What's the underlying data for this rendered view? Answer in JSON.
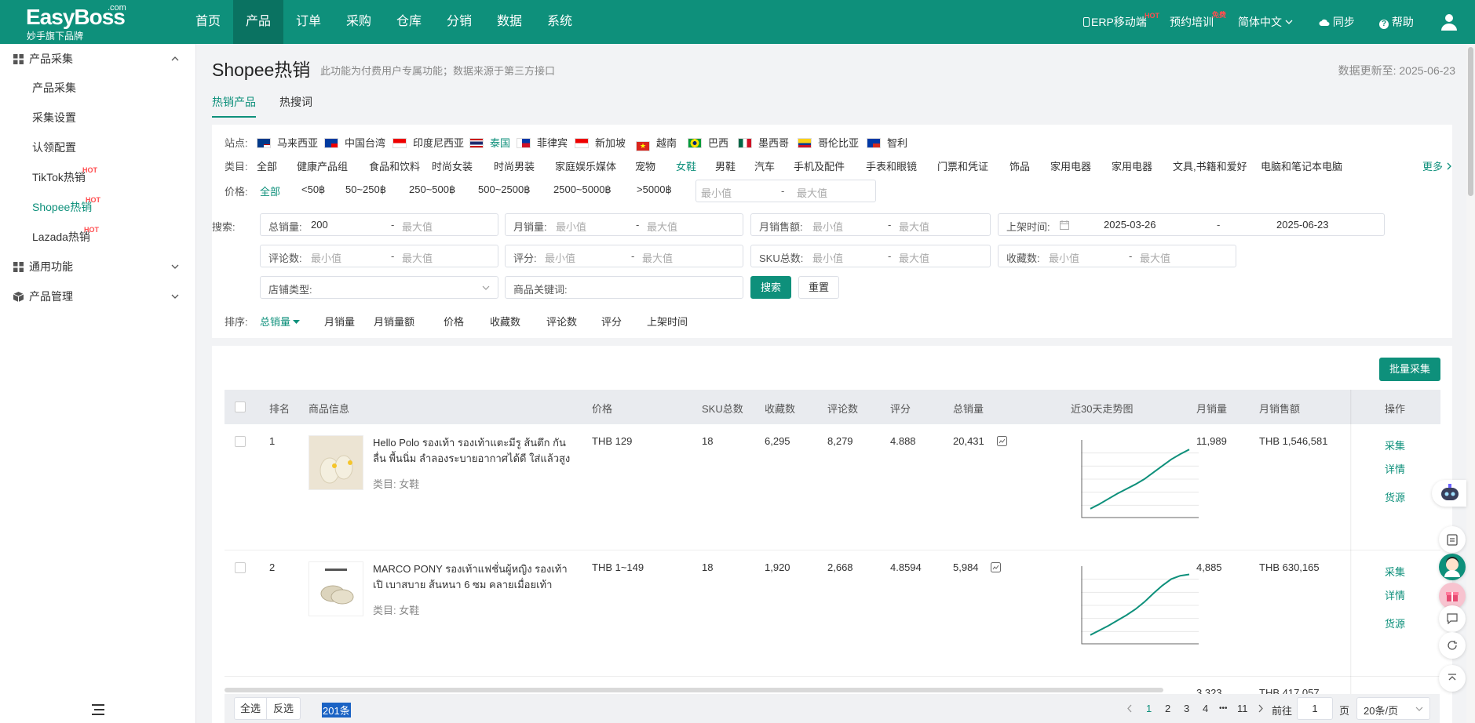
{
  "header": {
    "logo_main": "EasyBoss",
    "logo_com": ".com",
    "logo_sub": "妙手旗下品牌",
    "nav": [
      "首页",
      "产品",
      "订单",
      "采购",
      "仓库",
      "分销",
      "数据",
      "系统"
    ],
    "active_nav": "产品",
    "right": {
      "erp": "ERP移动端",
      "erp_badge": "HOT",
      "training": "预约培训",
      "training_badge": "免费",
      "lang": "简体中文",
      "sync": "同步",
      "help": "帮助"
    }
  },
  "sidebar": {
    "groups": [
      {
        "label": "产品采集",
        "expanded": true
      },
      {
        "label": "通用功能",
        "expanded": false
      },
      {
        "label": "产品管理",
        "expanded": false
      }
    ],
    "items": [
      {
        "label": "产品采集"
      },
      {
        "label": "采集设置"
      },
      {
        "label": "认领配置"
      },
      {
        "label": "TikTok热销",
        "badge": "HOT"
      },
      {
        "label": "Shopee热销",
        "badge": "HOT",
        "active": true
      },
      {
        "label": "Lazada热销",
        "badge": "HOT"
      }
    ]
  },
  "page": {
    "title": "Shopee热销",
    "note": "此功能为付费用户专属功能；数据来源于第三方接口",
    "updated": "数据更新至:  2025-06-23",
    "tabs": [
      "热销产品",
      "热搜词"
    ]
  },
  "filters": {
    "site_label": "站点:",
    "sites": [
      "马来西亚",
      "中国台湾",
      "印度尼西亚",
      "泰国",
      "菲律宾",
      "新加坡",
      "越南",
      "巴西",
      "墨西哥",
      "哥伦比亚",
      "智利"
    ],
    "active_site": "泰国",
    "category_label": "类目:",
    "categories": [
      "全部",
      "健康产品组",
      "食品和饮料",
      "时尚女装",
      "时尚男装",
      "家庭娱乐媒体",
      "宠物",
      "女鞋",
      "男鞋",
      "汽车",
      "手机及配件",
      "手表和眼镜",
      "门票和凭证",
      "饰品",
      "家用电器",
      "家用电器",
      "文具,书籍和爱好",
      "电脑和笔记本电脑"
    ],
    "active_category": "女鞋",
    "more": "更多",
    "price_label": "价格:",
    "prices": [
      "全部",
      "<50฿",
      "50~250฿",
      "250~500฿",
      "500~2500฿",
      "2500~5000฿",
      ">5000฿"
    ],
    "active_price": "全部",
    "min_ph": "最小值",
    "max_ph": "最大值",
    "dash": "-",
    "search_label": "搜索:",
    "total_sales": {
      "label": "总销量:",
      "min": "200"
    },
    "monthly_sales": {
      "label": "月销量:"
    },
    "monthly_amount": {
      "label": "月销售额:"
    },
    "listed": {
      "label": "上架时间:",
      "from": "2025-03-26",
      "to": "2025-06-23"
    },
    "reviews": {
      "label": "评论数:"
    },
    "rating": {
      "label": "评分:"
    },
    "sku": {
      "label": "SKU总数:"
    },
    "favorites": {
      "label": "收藏数:"
    },
    "store_type": "店铺类型:",
    "keyword": "商品关键词:",
    "search_btn": "搜索",
    "reset_btn": "重置",
    "sort_label": "排序:",
    "sorts": [
      "总销量",
      "月销量",
      "月销量额",
      "价格",
      "收藏数",
      "评论数",
      "评分",
      "上架时间"
    ],
    "active_sort": "总销量"
  },
  "table": {
    "batch_btn": "批量采集",
    "headers": [
      "排名",
      "商品信息",
      "价格",
      "SKU总数",
      "收藏数",
      "评论数",
      "评分",
      "总销量",
      "近30天走势图",
      "月销量",
      "月销售额",
      "操作"
    ],
    "rows": [
      {
        "rank": "1",
        "name": "Hello Polo รองเท้า รองเท้าแตะมีรู ส้นตึก กันลื่น พื้นนิ่ม ลำลองระบายอากาศได้ดี ใส่แล้วสูง ...",
        "category": "类目: 女鞋",
        "price": "THB 129",
        "sku": "18",
        "fav": "6,295",
        "reviews": "8,279",
        "rating": "4.888",
        "total": "20,431",
        "monthly": "11,989",
        "amount": "THB 1,546,581",
        "trend": [
          5,
          12,
          20,
          28,
          35,
          42,
          50,
          60,
          70,
          80,
          88,
          95
        ]
      },
      {
        "rank": "2",
        "name": "MARCO PONY รองเท้าแฟชั่นผู้หญิง รองเท้าเปิ เบาสบาย ส้นหนา 6 ซม คลายเมื่อยเท้า วัส...",
        "category": "类目: 女鞋",
        "price": "THB 1~149",
        "sku": "18",
        "fav": "1,920",
        "reviews": "2,668",
        "rating": "4.8594",
        "total": "5,984",
        "monthly": "4,885",
        "amount": "THB 630,165",
        "trend": [
          5,
          12,
          19,
          27,
          35,
          44,
          55,
          68,
          80,
          90,
          95,
          97
        ]
      }
    ],
    "partial_row": {
      "monthly": "3,323",
      "amount": "THB 417,057"
    },
    "ops": [
      "采集",
      "详情",
      "货源"
    ]
  },
  "pager": {
    "select_all": "全选",
    "invert": "反选",
    "count": "201条",
    "pages": [
      "1",
      "2",
      "3",
      "4",
      "•••",
      "11"
    ],
    "active_page": "1",
    "goto": "前往",
    "page_value": "1",
    "page_unit": "页",
    "size": "20条/页"
  },
  "colors": {
    "brand": "#0e907b",
    "hot": "#ff4d4f"
  }
}
